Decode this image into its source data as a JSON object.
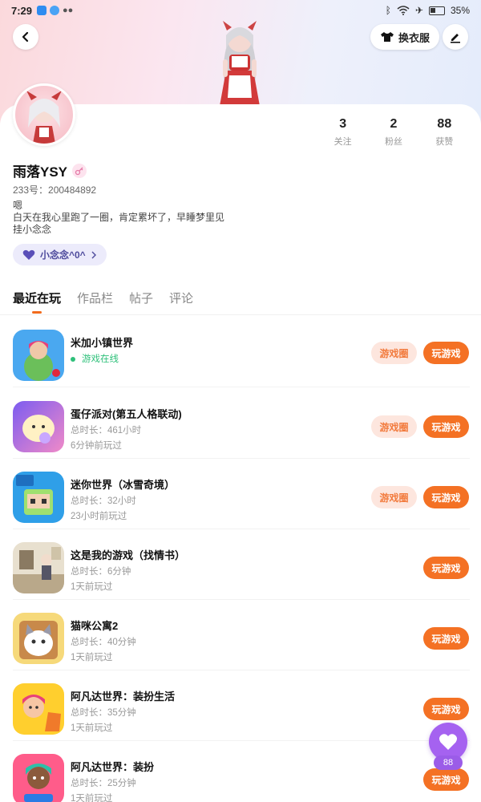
{
  "status_bar": {
    "time": "7:29",
    "battery": "35%"
  },
  "header": {
    "outfit_label": "换衣服"
  },
  "stats": [
    {
      "num": "3",
      "label": "关注"
    },
    {
      "num": "2",
      "label": "粉丝"
    },
    {
      "num": "88",
      "label": "获赞"
    }
  ],
  "profile": {
    "name": "雨落YSY",
    "uid": "233号：200484892",
    "bio_line1": "嗯",
    "bio_line2": "白天在我心里跑了一圈，肯定累坏了，早睡梦里见",
    "bio_line3": "挂小念念",
    "fan_pill": "小念念^0^"
  },
  "tabs": [
    "最近在玩",
    "作品栏",
    "帖子",
    "评论"
  ],
  "games": [
    {
      "title": "米加小镇世界",
      "line1": "游戏在线",
      "line2": "",
      "circle": "游戏圈",
      "play": "玩游戏"
    },
    {
      "title": "蛋仔派对(第五人格联动)",
      "line1": "总时长：461小时",
      "line2": "6分钟前玩过",
      "circle": "游戏圈",
      "play": "玩游戏"
    },
    {
      "title": "迷你世界（冰雪奇境）",
      "line1": "总时长：32小时",
      "line2": "23小时前玩过",
      "circle": "游戏圈",
      "play": "玩游戏"
    },
    {
      "title": "这是我的游戏（找情书）",
      "line1": "总时长：6分钟",
      "line2": "1天前玩过",
      "circle": "",
      "play": "玩游戏"
    },
    {
      "title": "猫咪公寓2",
      "line1": "总时长：40分钟",
      "line2": "1天前玩过",
      "circle": "",
      "play": "玩游戏"
    },
    {
      "title": "阿凡达世界：装扮生活",
      "line1": "总时长：35分钟",
      "line2": "1天前玩过",
      "circle": "",
      "play": "玩游戏"
    },
    {
      "title": "阿凡达世界：装扮",
      "line1": "总时长：25分钟",
      "line2": "1天前玩过",
      "circle": "",
      "play": "玩游戏"
    }
  ],
  "fab": {
    "count": "88"
  },
  "colors": {
    "accent": "#f47124",
    "circle_bg": "#fde6de",
    "fab": "#a562f0",
    "online": "#2ec07a"
  }
}
